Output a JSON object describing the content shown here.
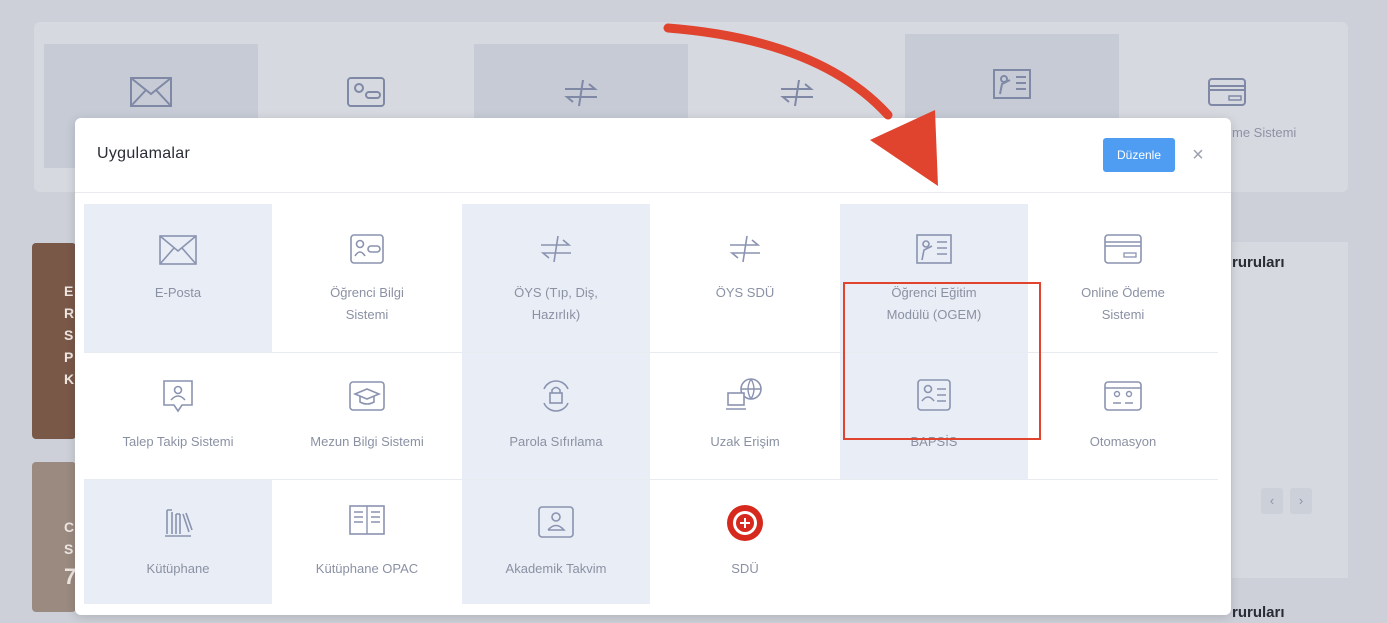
{
  "background": {
    "tiles": [
      {
        "label": ""
      },
      {
        "label": ""
      },
      {
        "label": ""
      },
      {
        "label": ""
      },
      {
        "label": ""
      },
      {
        "label": "me Sistemi"
      }
    ],
    "left_card_letters": [
      "E",
      "R",
      "S",
      "P",
      "K"
    ],
    "left_card2_letters": [
      "C",
      "S",
      "7"
    ],
    "right_title_1": "ruruları",
    "right_title_2": "ruruları",
    "pager": {
      "prev": "‹",
      "next": "›"
    }
  },
  "modal": {
    "title": "Uygulamalar",
    "edit_label": "Düzenle",
    "close_label": "×",
    "apps": [
      {
        "label_lines": [
          "E-Posta"
        ],
        "icon": "envelope-icon"
      },
      {
        "label_lines": [
          "Öğrenci Bilgi",
          "Sistemi"
        ],
        "icon": "student-card-icon"
      },
      {
        "label_lines": [
          "ÖYS (Tıp, Diş,",
          "Hazırlık)"
        ],
        "icon": "swap-arrows-icon"
      },
      {
        "label_lines": [
          "ÖYS SDÜ"
        ],
        "icon": "swap-arrows-icon"
      },
      {
        "label_lines": [
          "Öğrenci Eğitim",
          "Modülü (OGEM)"
        ],
        "icon": "teacher-board-icon"
      },
      {
        "label_lines": [
          "Online Ödeme",
          "Sistemi"
        ],
        "icon": "credit-card-icon"
      },
      {
        "label_lines": [
          "Talep Takip Sistemi"
        ],
        "icon": "user-chat-icon"
      },
      {
        "label_lines": [
          "Mezun Bilgi Sistemi"
        ],
        "icon": "graduation-cap-icon"
      },
      {
        "label_lines": [
          "Parola Sıfırlama"
        ],
        "icon": "lock-reset-icon"
      },
      {
        "label_lines": [
          "Uzak Erişim"
        ],
        "icon": "remote-globe-icon"
      },
      {
        "label_lines": [
          "BAPSİS"
        ],
        "icon": "id-card-icon"
      },
      {
        "label_lines": [
          "Otomasyon"
        ],
        "icon": "users-panel-icon"
      },
      {
        "label_lines": [
          "Kütüphane"
        ],
        "icon": "books-icon"
      },
      {
        "label_lines": [
          "Kütüphane OPAC"
        ],
        "icon": "open-book-icon"
      },
      {
        "label_lines": [
          "Akademik Takvim"
        ],
        "icon": "user-calendar-icon"
      },
      {
        "label_lines": [
          "SDÜ"
        ],
        "icon": "university-seal-icon"
      }
    ]
  },
  "colors": {
    "accent": "#4f9df2",
    "highlight": "#e0442e",
    "arrow": "#e0442e",
    "icon": "#8a93b0"
  }
}
